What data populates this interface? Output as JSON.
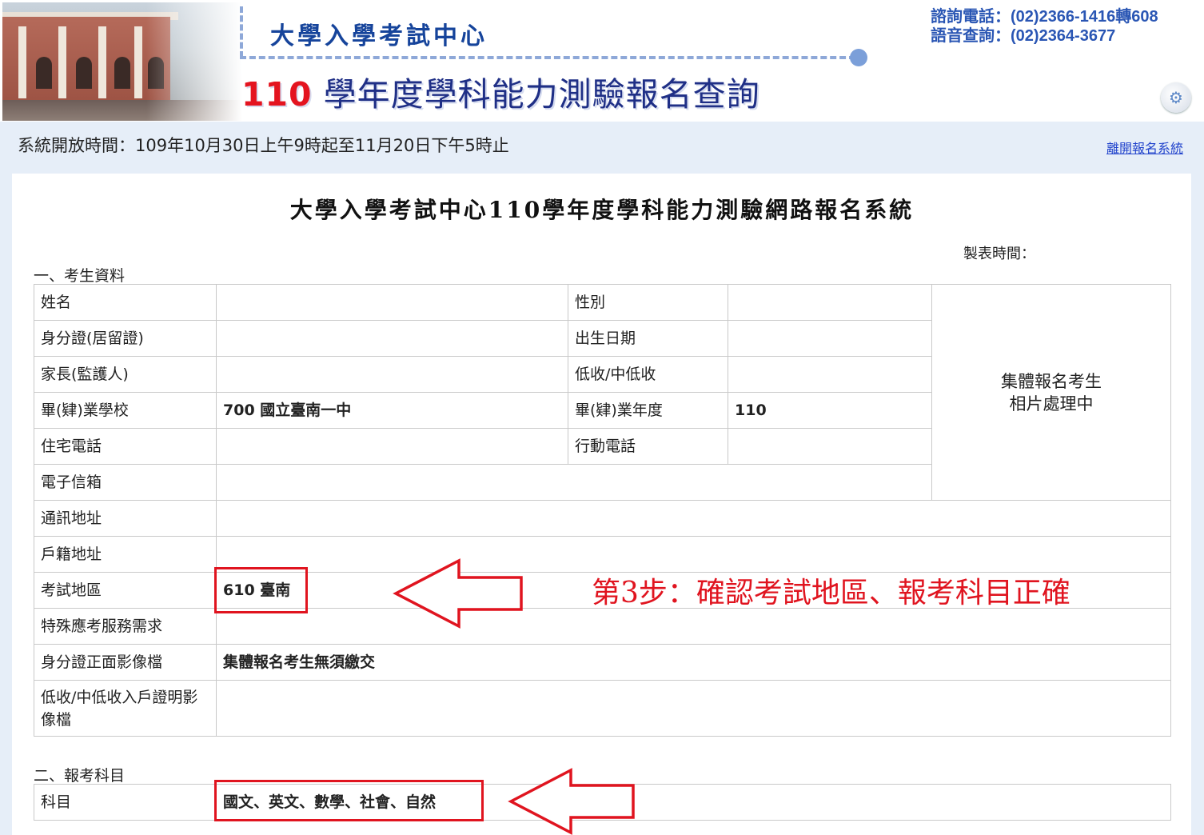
{
  "header": {
    "center_name": "大學入學考試中心",
    "title_year": "110",
    "title_rest": " 學年度學科能力測驗報名查詢",
    "phone_inquiry": "諮詢電話：(02)2366-1416轉608",
    "phone_voice": "語音查詢：(02)2364-3677"
  },
  "system_bar": {
    "open_time": "系統開放時間：109年10月30日上午9時起至11月20日下午5時止",
    "exit_link": "離開報名系統"
  },
  "form": {
    "title": "大學入學考試中心110學年度學科能力測驗網路報名系統",
    "made_time_label": "製表時間："
  },
  "section1": {
    "label": "一、考生資料",
    "name_label": "姓名",
    "name_value": "",
    "gender_label": "性別",
    "gender_value": "",
    "id_label": "身分證(居留證)",
    "id_value": "",
    "birth_label": "出生日期",
    "birth_value": "",
    "guardian_label": "家長(監護人)",
    "guardian_value": "",
    "income_label": "低收/中低收",
    "income_value": "",
    "school_label": "畢(肄)業學校",
    "school_value": "700 國立臺南一中",
    "grad_year_label": "畢(肄)業年度",
    "grad_year_value": "110",
    "home_phone_label": "住宅電話",
    "home_phone_value": "",
    "mobile_label": "行動電話",
    "mobile_value": "",
    "email_label": "電子信箱",
    "email_value": "",
    "mail_addr_label": "通訊地址",
    "mail_addr_value": "",
    "reg_addr_label": "戶籍地址",
    "reg_addr_value": "",
    "exam_area_label": "考試地區",
    "exam_area_value": "610 臺南",
    "special_label": "特殊應考服務需求",
    "special_value": "",
    "id_image_label": "身分證正面影像檔",
    "id_image_value": "集體報名考生無須繳交",
    "income_image_label": "低收/中低收入戶證明影像檔",
    "income_image_value": "",
    "photo_line1": "集體報名考生",
    "photo_line2": "相片處理中"
  },
  "section2": {
    "label": "二、報考科目",
    "subject_label": "科目",
    "subject_value": "國文、英文、數學、社會、自然"
  },
  "annotation": {
    "step_text": "第3步：確認考試地區、報考科目正確",
    "accent_color": "#e0141f"
  }
}
